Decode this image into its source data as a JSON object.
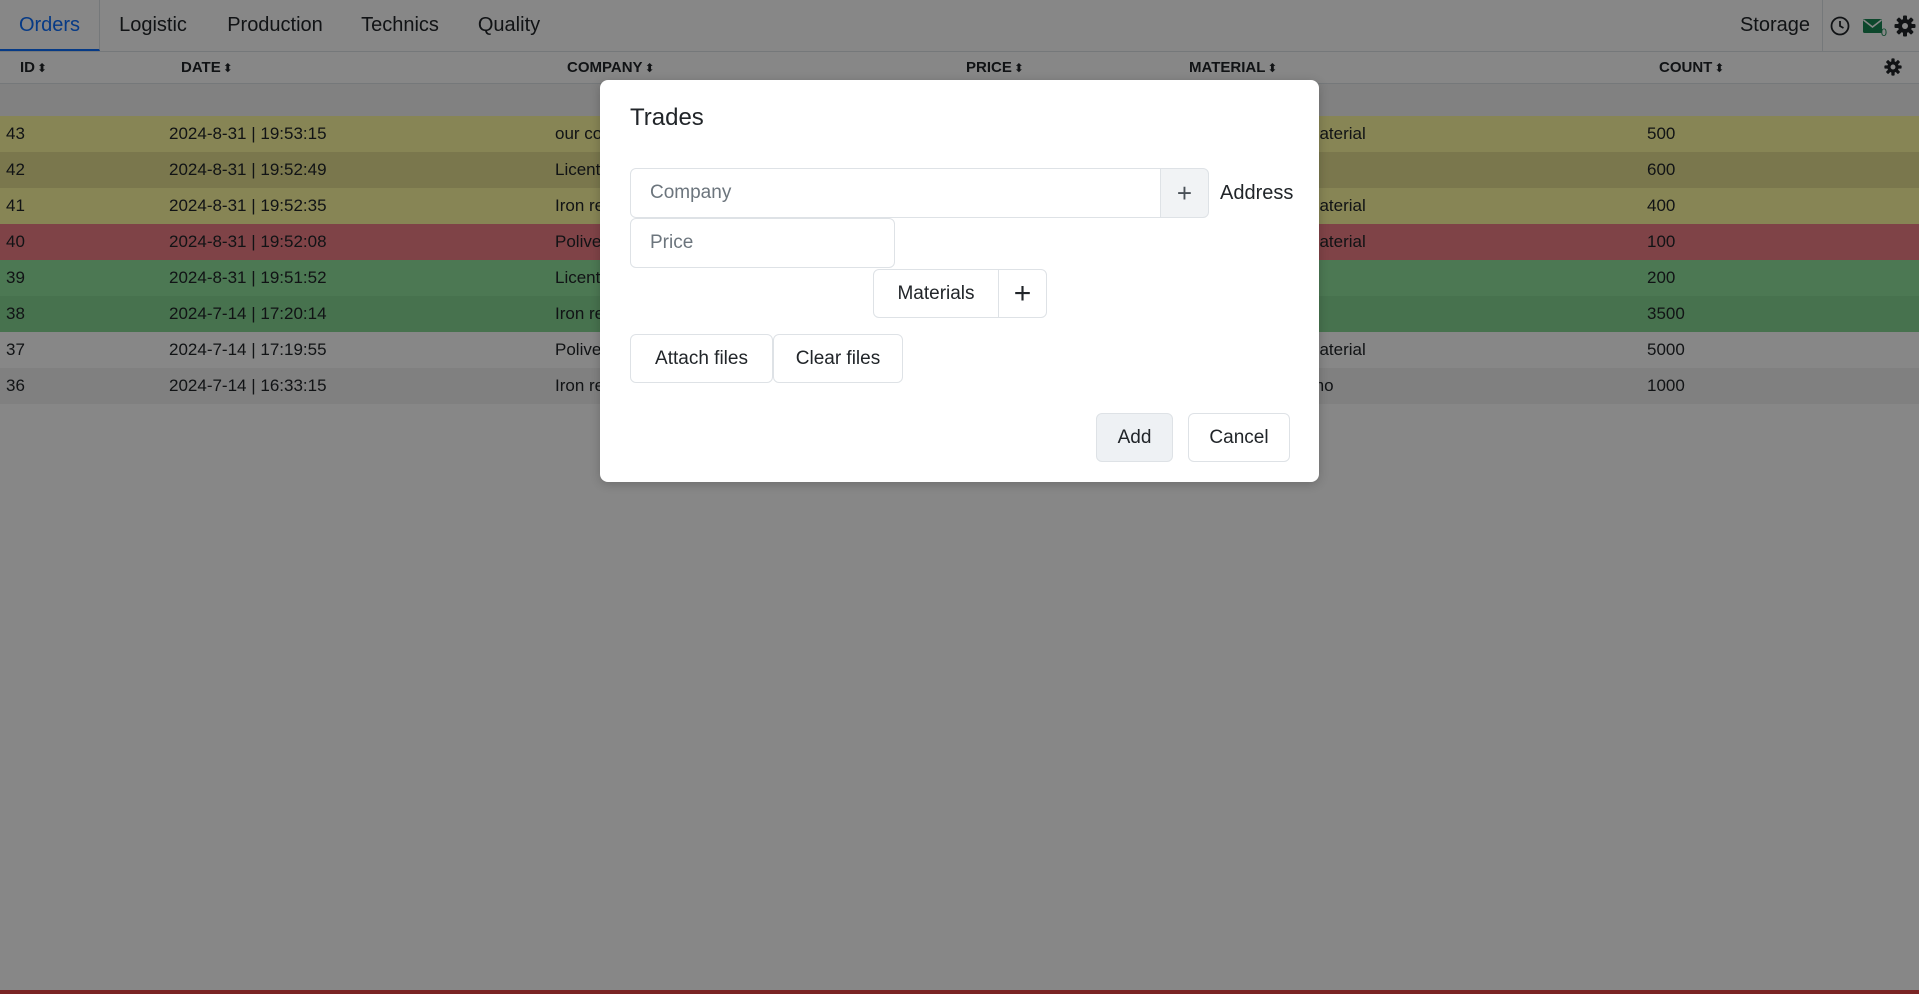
{
  "nav": {
    "tabs": [
      "Orders",
      "Logistic",
      "Production",
      "Technics",
      "Quality"
    ],
    "storage_label": "Storage",
    "mail_count": "0"
  },
  "table": {
    "headers": [
      "ID",
      "DATE",
      "COMPANY",
      "PRICE",
      "MATERIAL",
      "COUNT"
    ],
    "rows": [
      {
        "id": "43",
        "date": "2024-8-31 | 19:53:15",
        "company": "our co",
        "material": "naterial",
        "count": "500",
        "color": "#fffca0"
      },
      {
        "id": "42",
        "date": "2024-8-31 | 19:52:49",
        "company": "Licent",
        "material": "",
        "count": "600",
        "color": "#e6e192"
      },
      {
        "id": "41",
        "date": "2024-8-31 | 19:52:35",
        "company": "Iron re",
        "material": "naterial",
        "count": "400",
        "color": "#fffca0"
      },
      {
        "id": "40",
        "date": "2024-8-31 | 19:52:08",
        "company": "Polive",
        "material": "naterial",
        "count": "100",
        "color": "#f07f86"
      },
      {
        "id": "39",
        "date": "2024-8-31 | 19:51:52",
        "company": "Licent",
        "material": "",
        "count": "200",
        "color": "#90e29e"
      },
      {
        "id": "38",
        "date": "2024-7-14 | 17:20:14",
        "company": "Iron re",
        "material": "",
        "count": "3500",
        "color": "#86d793"
      },
      {
        "id": "37",
        "date": "2024-7-14 | 17:19:55",
        "company": "Polive",
        "material": "naterial",
        "count": "5000",
        "color": "#ffffff"
      },
      {
        "id": "36",
        "date": "2024-7-14 | 16:33:15",
        "company": "Iron re",
        "material": "mo",
        "count": "1000",
        "color": "#f2f2f2"
      }
    ]
  },
  "modal": {
    "title": "Trades",
    "company_placeholder": "Company",
    "address_label": "Address",
    "price_placeholder": "Price",
    "materials_label": "Materials",
    "attach_label": "Attach files",
    "clear_label": "Clear files",
    "add_label": "Add",
    "cancel_label": "Cancel"
  },
  "icons": {
    "history": "clock-icon",
    "mail": "mail-icon",
    "settings": "gear-icon",
    "column_settings": "gear-icon",
    "add": "plus-icon"
  },
  "colors": {
    "accent": "#0d6efd",
    "mail_icon": "#198754"
  }
}
